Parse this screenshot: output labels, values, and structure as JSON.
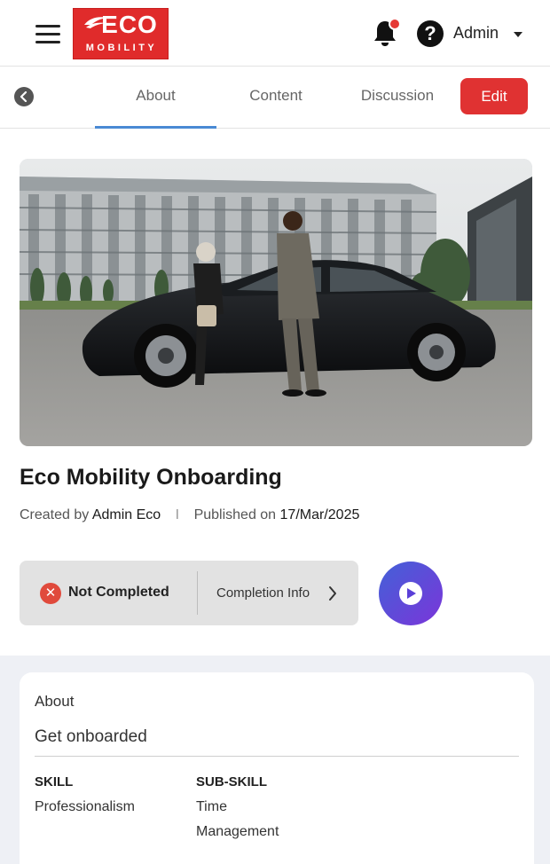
{
  "header": {
    "logo_top": "ECO",
    "logo_bottom": "MOBILITY",
    "user_name": "Admin",
    "help_glyph": "?",
    "notification_dot_color": "#e53935"
  },
  "tabs": {
    "items": [
      {
        "label": "About",
        "active": true
      },
      {
        "label": "Content",
        "active": false
      },
      {
        "label": "Discussion",
        "active": false
      }
    ],
    "edit_label": "Edit",
    "accent": "#e03232"
  },
  "course": {
    "title": "Eco Mobility Onboarding",
    "created_by_label": "Created by",
    "created_by": "Admin Eco",
    "separator": "I",
    "published_on_label": "Published on",
    "published_on": "17/Mar/2025"
  },
  "status": {
    "state": "Not Completed",
    "completion_info_label": "Completion Info",
    "icon": "x-icon"
  },
  "about": {
    "heading": "About",
    "description": "Get onboarded",
    "skill_heading": "SKILL",
    "skill_value": "Professionalism",
    "subskill_heading": "SUB-SKILL",
    "subskill_value_line1": "Time",
    "subskill_value_line2": "Management"
  }
}
